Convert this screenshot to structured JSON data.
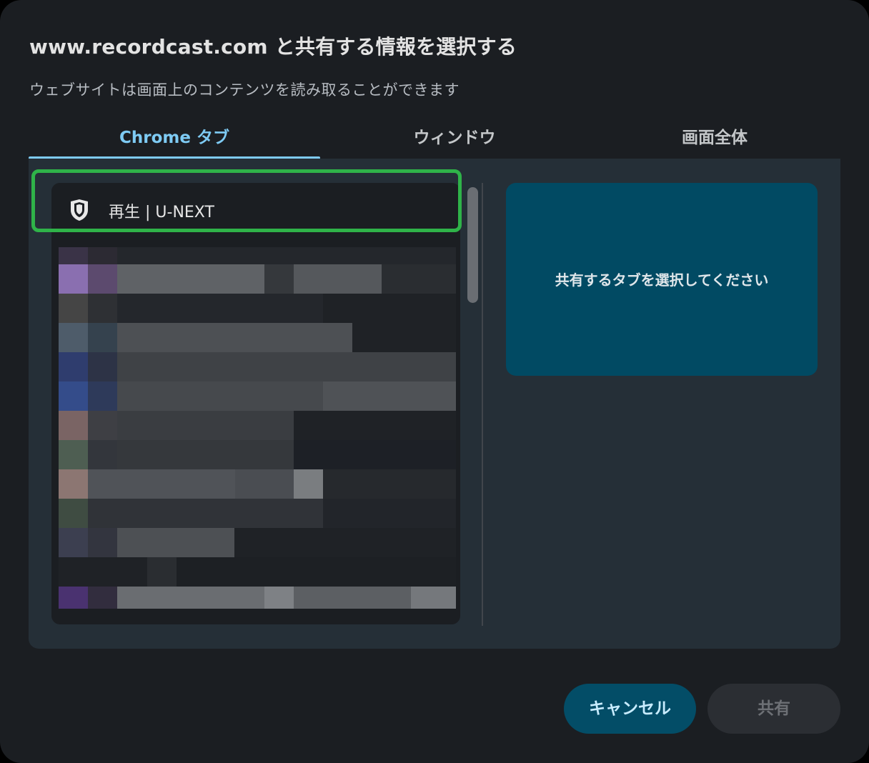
{
  "dialog": {
    "title": "www.recordcast.com と共有する情報を選択する",
    "subtitle": "ウェブサイトは画面上のコンテンツを読み取ることができます"
  },
  "tabs": [
    {
      "label": "Chrome タブ",
      "selected": true
    },
    {
      "label": "ウィンドウ",
      "selected": false
    },
    {
      "label": "画面全体",
      "selected": false
    }
  ],
  "tab_list": {
    "highlighted_item": {
      "label": "再生 | U-NEXT",
      "icon": "shield-icon"
    }
  },
  "preview": {
    "message": "共有するタブを選択してください"
  },
  "buttons": {
    "cancel_label": "キャンセル",
    "share_label": "共有"
  },
  "colors": {
    "accent": "#7ecbf4",
    "highlight_border": "#2fb349",
    "preview_bg": "#014a63",
    "cancel_bg": "#034d67"
  }
}
